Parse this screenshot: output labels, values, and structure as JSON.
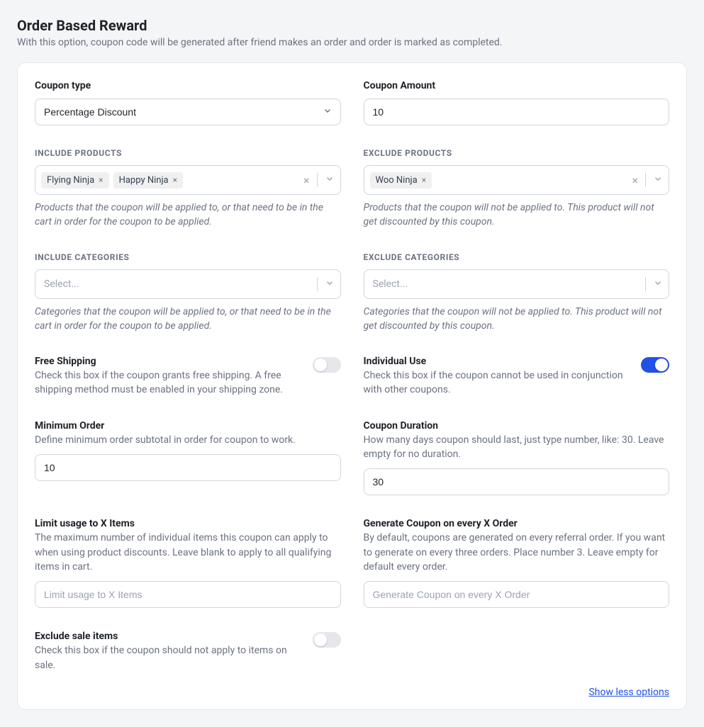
{
  "header": {
    "title": "Order Based Reward",
    "subtitle": "With this option, coupon code will be generated after friend makes an order and order is marked as completed."
  },
  "couponType": {
    "label": "Coupon type",
    "value": "Percentage Discount"
  },
  "couponAmount": {
    "label": "Coupon Amount",
    "value": "10"
  },
  "includeProducts": {
    "label": "INCLUDE PRODUCTS",
    "tags": [
      "Flying Ninja",
      "Happy Ninja"
    ],
    "help": "Products that the coupon will be applied to, or that need to be in the cart in order for the coupon to be applied."
  },
  "excludeProducts": {
    "label": "EXCLUDE PRODUCTS",
    "tags": [
      "Woo Ninja"
    ],
    "help": "Products that the coupon will not be applied to. This product will not get discounted by this coupon."
  },
  "includeCategories": {
    "label": "INCLUDE CATEGORIES",
    "placeholder": "Select...",
    "help": "Categories that the coupon will be applied to, or that need to be in the cart in order for the coupon to be applied."
  },
  "excludeCategories": {
    "label": "EXCLUDE CATEGORIES",
    "placeholder": "Select...",
    "help": "Categories that the coupon will not be applied to. This product will not get discounted by this coupon."
  },
  "freeShipping": {
    "label": "Free Shipping",
    "desc": "Check this box if the coupon grants free shipping. A free shipping method must be enabled in your shipping zone.",
    "value": false
  },
  "individualUse": {
    "label": "Individual Use",
    "desc": "Check this box if the coupon cannot be used in conjunction with other coupons.",
    "value": true
  },
  "minimumOrder": {
    "label": "Minimum Order",
    "desc": "Define minimum order subtotal in order for coupon to work.",
    "value": "10"
  },
  "couponDuration": {
    "label": "Coupon Duration",
    "desc": "How many days coupon should last, just type number, like: 30. Leave empty for no duration.",
    "value": "30"
  },
  "limitUsage": {
    "label": "Limit usage to X Items",
    "desc": "The maximum number of individual items this coupon can apply to when using product discounts. Leave blank to apply to all qualifying items in cart.",
    "placeholder": "Limit usage to X Items",
    "value": ""
  },
  "generateEvery": {
    "label": "Generate Coupon on every X Order",
    "desc": "By default, coupons are generated on every referral order. If you want to generate on every three orders. Place number 3. Leave empty for default every order.",
    "placeholder": "Generate Coupon on every X Order",
    "value": ""
  },
  "excludeSale": {
    "label": "Exclude sale items",
    "desc": "Check this box if the coupon should not apply to items on sale.",
    "value": false
  },
  "footer": {
    "link": "Show less options"
  },
  "icons": {
    "x": "×"
  }
}
